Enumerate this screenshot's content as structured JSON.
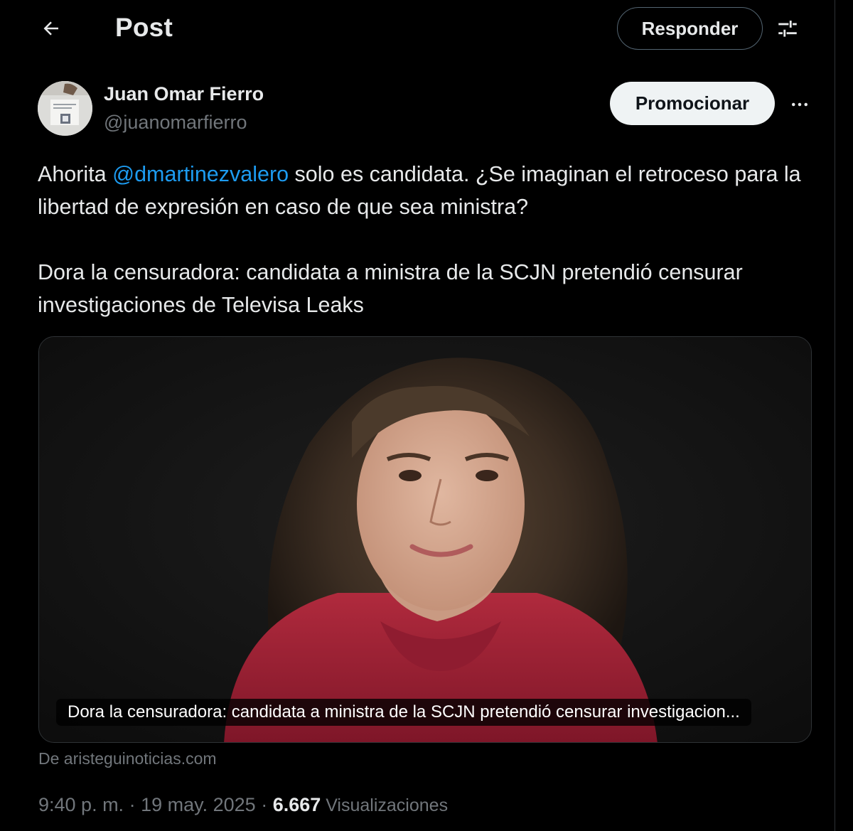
{
  "header": {
    "title": "Post",
    "reply_label": "Responder"
  },
  "author": {
    "name": "Juan Omar Fierro",
    "handle": "@juanomarfierro",
    "promote_label": "Promocionar"
  },
  "tweet": {
    "text_before": "Ahorita ",
    "mention": "@dmartinezvalero",
    "text_after": " solo es candidata. ¿Se imaginan el retroceso para la libertad de expresión en caso de que sea ministra?",
    "paragraph_2": "Dora la censuradora: candidata a ministra de la SCJN pretendió censurar investigaciones de Televisa Leaks"
  },
  "card": {
    "caption": "Dora la censuradora: candidata a ministra de la SCJN pretendió censurar investigacion...",
    "source": "De aristeguinoticias.com"
  },
  "meta": {
    "time": "9:40 p. m.",
    "sep1": " · ",
    "date": "19 may. 2025",
    "sep2": " · ",
    "views_count": "6.667",
    "views_label": " Visualizaciones"
  },
  "icons": {
    "back": "arrow-left-icon",
    "filter": "sliders-icon",
    "more": "more-horizontal-icon"
  },
  "colors": {
    "background": "#000000",
    "text": "#e7e9ea",
    "secondary": "#71767b",
    "link": "#1d9bf0",
    "border": "#2f3336",
    "promote_bg": "#eff3f4"
  }
}
